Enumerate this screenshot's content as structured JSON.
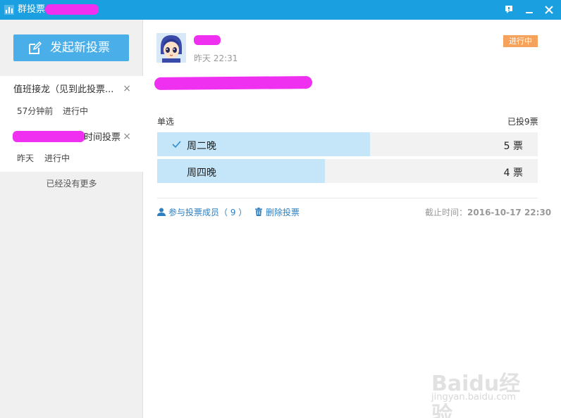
{
  "window": {
    "title": "群投票-",
    "feedback_icon": "feedback-icon",
    "minimize_icon": "minimize-icon",
    "close_icon": "close-icon"
  },
  "sidebar": {
    "new_vote_label": "发起新投票",
    "items": [
      {
        "title": "值班接龙（见到此投票...",
        "time": "57分钟前",
        "status": "进行中"
      },
      {
        "title": "时间投票",
        "time": "昨天",
        "status": "进行中"
      }
    ],
    "close_glyph": "×",
    "no_more": "已经没有更多"
  },
  "vote": {
    "post_time": "昨天 22:31",
    "status": "进行中",
    "type": "单选",
    "total": "已投9票",
    "options": [
      {
        "label": "周二晚",
        "count": "5 票",
        "votes": 5,
        "selected": true
      },
      {
        "label": "周四晚",
        "count": "4 票",
        "votes": 4,
        "selected": false
      }
    ],
    "members_link": "参与投票成员（ 9 ）",
    "delete_link": "删除投票",
    "deadline_label": "截止时间：",
    "deadline_value": "2016-10-17 22:30"
  },
  "watermark": {
    "text": "Baidu经验",
    "url": "jingyan.baidu.com"
  },
  "colors": {
    "titlebar": "#1a9fe0",
    "primary_button": "#4aaee8",
    "selected_bar": "#c4e6f8",
    "status_badge": "#f5a25d",
    "link": "#2d7fc1",
    "redaction": "#f030f0"
  }
}
